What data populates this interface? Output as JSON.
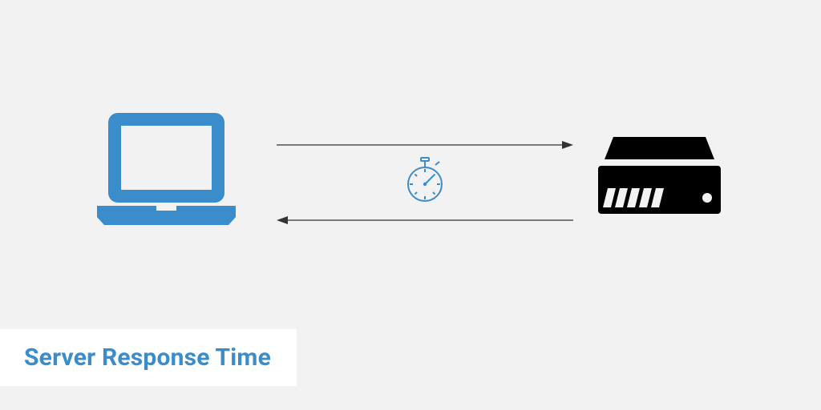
{
  "title": "Server Response Time",
  "colors": {
    "accent": "#3a8dca",
    "bg": "#f2f2f2",
    "titleBg": "#ffffff",
    "serverIcon": "#000000",
    "arrow": "#333333"
  },
  "icons": {
    "laptop": "laptop-icon",
    "server": "server-icon",
    "stopwatch": "stopwatch-icon"
  },
  "arrows": {
    "request": "right",
    "response": "left"
  }
}
